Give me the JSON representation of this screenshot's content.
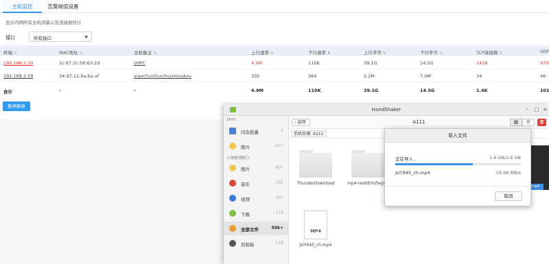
{
  "tabs": [
    {
      "label": "主机监控"
    },
    {
      "label": "告警阈值设置"
    }
  ],
  "description": "显示内网所有主机流量以及连接数统计",
  "filter": {
    "label": "接口",
    "value": "所有接口"
  },
  "table": {
    "headers": [
      "终端",
      "MAC地址",
      "主机备注",
      "上行速率",
      "下行速率",
      "上行字节",
      "下行字节",
      "TCP连接数",
      "UDP"
    ],
    "rows": [
      [
        "192.168.2.39",
        "1c:87:2c:56:63:2d",
        "zHPC",
        "4.9M",
        "110K",
        "39.1G",
        "14.5G",
        "1428",
        "970"
      ],
      [
        "192.168.2.59",
        "34:d7:12:9a:ba:af",
        "xiaochuichuichuixiongkou",
        "332",
        "364",
        "2.2M",
        "7.0M",
        "34",
        "46"
      ],
      [
        "合计",
        "-",
        "-",
        "4.9M",
        "110K",
        "39.1G",
        "14.5G",
        "1.4K",
        "101"
      ]
    ]
  },
  "pause_refresh": "暂停刷新",
  "handshaker": {
    "title": "HandShaker",
    "sidebar": {
      "group1": "ZHPC",
      "items1": [
        {
          "label": "闪念胶囊",
          "count": "0",
          "icon": "capsule-icon",
          "color": "#4a7fd6"
        },
        {
          "label": "图片",
          "count": "2k+",
          "icon": "image-icon",
          "color": "#f2c94c"
        }
      ],
      "group2": "小锤锤锤胸口",
      "items2": [
        {
          "label": "图片",
          "count": "837",
          "icon": "image-icon",
          "color": "#f2c94c"
        },
        {
          "label": "音乐",
          "count": "265",
          "icon": "music-icon",
          "color": "#e0443a"
        },
        {
          "label": "视频",
          "count": "267",
          "icon": "video-icon",
          "color": "#3a7be0"
        },
        {
          "label": "下载",
          "count": "179",
          "icon": "download-icon",
          "color": "#7bc142"
        },
        {
          "label": "全部文件",
          "count": "50k+",
          "icon": "all-files-icon",
          "color": "#f09a36"
        },
        {
          "label": "剪贴板",
          "count": "128",
          "icon": "clipboard-icon",
          "color": "#555555"
        }
      ]
    },
    "toolbar": {
      "back": "返回",
      "folder": "A111"
    },
    "crumbs": [
      "手机存储",
      "A111"
    ],
    "files": [
      "ThunderDownload",
      "mp4-reddit/rsfiegifa",
      "JUY945_ch.mp4"
    ],
    "file_ext": "MP4",
    "thumb_label": "mp4"
  },
  "dialog": {
    "title": "导入文件",
    "status": "正在导入...",
    "size": "1.6 GB/2.6 GB",
    "progress": 0.62,
    "filename": "JUY945_ch.mp4",
    "speed": "19.98 MB/s",
    "cancel": "取消"
  }
}
